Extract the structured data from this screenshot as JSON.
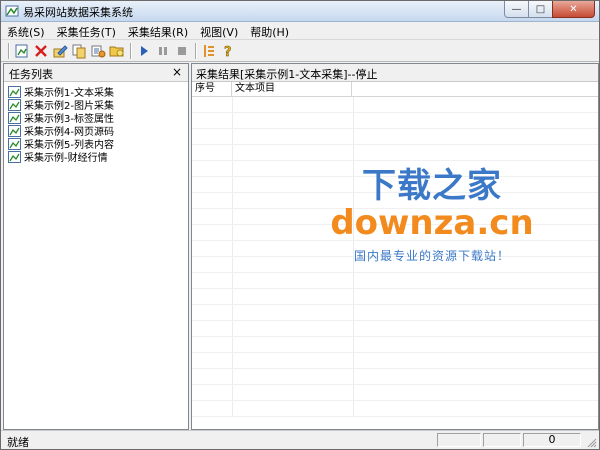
{
  "window": {
    "title": "易采网站数据采集系统",
    "minimize_glyph": "—",
    "maximize_glyph": "□",
    "close_glyph": "✕"
  },
  "menu": [
    {
      "label": "系统(S)"
    },
    {
      "label": "采集任务(T)"
    },
    {
      "label": "采集结果(R)"
    },
    {
      "label": "视图(V)"
    },
    {
      "label": "帮助(H)"
    }
  ],
  "toolbar_icons": [
    "new-task-icon",
    "delete-icon",
    "edit-icon",
    "copy-icon",
    "properties-icon",
    "folder-icon",
    "play-icon",
    "pause-icon",
    "stop-icon",
    "list-view-icon",
    "help-icon"
  ],
  "left_pane": {
    "title": "任务列表",
    "close_glyph": "×",
    "tasks": [
      {
        "label": "采集示例1-文本采集"
      },
      {
        "label": "采集示例2-图片采集"
      },
      {
        "label": "采集示例3-标签属性"
      },
      {
        "label": "采集示例4-网页源码"
      },
      {
        "label": "采集示例5-列表内容"
      },
      {
        "label": "采集示例-财经行情"
      }
    ]
  },
  "right_pane": {
    "title": "采集结果[采集示例1-文本采集]--停止",
    "columns": [
      {
        "label": "序号"
      },
      {
        "label": "文本项目"
      },
      {
        "label": ""
      }
    ]
  },
  "watermark": {
    "cn": "下载之家",
    "en": "downza.cn",
    "slogan": "国内最专业的资源下载站！"
  },
  "statusbar": {
    "text": "就绪",
    "count": "0"
  },
  "colors": {
    "watermark_blue": "#3b79c8",
    "watermark_orange": "#f28a1e",
    "close_red": "#c64a32"
  }
}
